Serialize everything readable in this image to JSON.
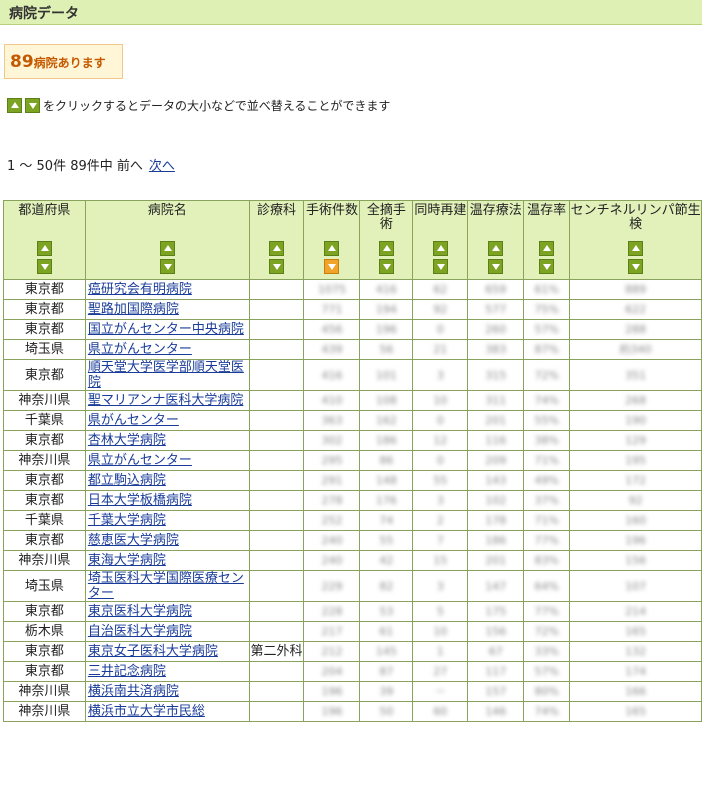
{
  "header": {
    "title": "病院データ"
  },
  "summary": {
    "count": "89",
    "suffix": "病院あります"
  },
  "sort_hint": "をクリックするとデータの大小などで並べ替えることができます",
  "pager": {
    "range": "1 〜 50件 89件中 前へ",
    "next": "次へ"
  },
  "table": {
    "headers": [
      "都道府県",
      "病院名",
      "診療科",
      "手術件数",
      "全摘手術",
      "同時再建",
      "温存療法",
      "温存率",
      "センチネルリンパ節生検"
    ],
    "active_sort": {
      "column": 3,
      "direction": "down"
    },
    "rows": [
      {
        "pref": "東京都",
        "name": "癌研究会有明病院",
        "dept": "",
        "v": [
          "1075",
          "416",
          "62",
          "659",
          "61%",
          "889"
        ]
      },
      {
        "pref": "東京都",
        "name": "聖路加国際病院",
        "dept": "",
        "v": [
          "771",
          "194",
          "92",
          "577",
          "75%",
          "622"
        ]
      },
      {
        "pref": "東京都",
        "name": "国立がんセンター中央病院",
        "dept": "",
        "v": [
          "456",
          "196",
          "0",
          "260",
          "57%",
          "288"
        ]
      },
      {
        "pref": "埼玉県",
        "name": "県立がんセンター",
        "dept": "",
        "v": [
          "439",
          "56",
          "21",
          "383",
          "87%",
          "約340"
        ]
      },
      {
        "pref": "東京都",
        "name": "順天堂大学医学部順天堂医院",
        "dept": "",
        "v": [
          "416",
          "101",
          "3",
          "315",
          "72%",
          "351"
        ]
      },
      {
        "pref": "神奈川県",
        "name": "聖マリアンナ医科大学病院",
        "dept": "",
        "v": [
          "410",
          "108",
          "10",
          "311",
          "74%",
          "268"
        ]
      },
      {
        "pref": "千葉県",
        "name": "県がんセンター",
        "dept": "",
        "v": [
          "363",
          "162",
          "0",
          "201",
          "55%",
          "190"
        ]
      },
      {
        "pref": "東京都",
        "name": "杏林大学病院",
        "dept": "",
        "v": [
          "302",
          "186",
          "12",
          "116",
          "38%",
          "129"
        ]
      },
      {
        "pref": "神奈川県",
        "name": "県立がんセンター",
        "dept": "",
        "v": [
          "295",
          "86",
          "0",
          "209",
          "71%",
          "195"
        ]
      },
      {
        "pref": "東京都",
        "name": "都立駒込病院",
        "dept": "",
        "v": [
          "291",
          "148",
          "55",
          "143",
          "49%",
          "172"
        ]
      },
      {
        "pref": "東京都",
        "name": "日本大学板橋病院",
        "dept": "",
        "v": [
          "278",
          "176",
          "3",
          "102",
          "37%",
          "92"
        ]
      },
      {
        "pref": "千葉県",
        "name": "千葉大学病院",
        "dept": "",
        "v": [
          "252",
          "74",
          "2",
          "178",
          "71%",
          "160"
        ]
      },
      {
        "pref": "東京都",
        "name": "慈恵医大学病院",
        "dept": "",
        "v": [
          "240",
          "55",
          "7",
          "186",
          "77%",
          "196"
        ]
      },
      {
        "pref": "神奈川県",
        "name": "東海大学病院",
        "dept": "",
        "v": [
          "240",
          "42",
          "15",
          "201",
          "83%",
          "156"
        ]
      },
      {
        "pref": "埼玉県",
        "name": "埼玉医科大学国際医療センター",
        "dept": "",
        "v": [
          "229",
          "82",
          "3",
          "147",
          "64%",
          "107"
        ]
      },
      {
        "pref": "東京都",
        "name": "東京医科大学病院",
        "dept": "",
        "v": [
          "228",
          "53",
          "5",
          "175",
          "77%",
          "214"
        ]
      },
      {
        "pref": "栃木県",
        "name": "自治医科大学病院",
        "dept": "",
        "v": [
          "217",
          "61",
          "10",
          "156",
          "72%",
          "165"
        ]
      },
      {
        "pref": "東京都",
        "name": "東京女子医科大学病院",
        "dept": "第二外科",
        "v": [
          "212",
          "145",
          "1",
          "67",
          "33%",
          "132"
        ]
      },
      {
        "pref": "東京都",
        "name": "三井記念病院",
        "dept": "",
        "v": [
          "204",
          "87",
          "27",
          "117",
          "57%",
          "174"
        ]
      },
      {
        "pref": "神奈川県",
        "name": "横浜南共済病院",
        "dept": "",
        "v": [
          "196",
          "39",
          "－",
          "157",
          "80%",
          "166"
        ]
      },
      {
        "pref": "神奈川県",
        "name": "横浜市立大学市民総",
        "dept": "",
        "v": [
          "196",
          "50",
          "60",
          "146",
          "74%",
          "165"
        ]
      }
    ]
  },
  "colors": {
    "header_bg": "#dff0b4",
    "table_head": "#e2f1ba",
    "sort_button": "#7ca322",
    "active_sort": "#f0a52a",
    "count_text": "#c45a00"
  }
}
